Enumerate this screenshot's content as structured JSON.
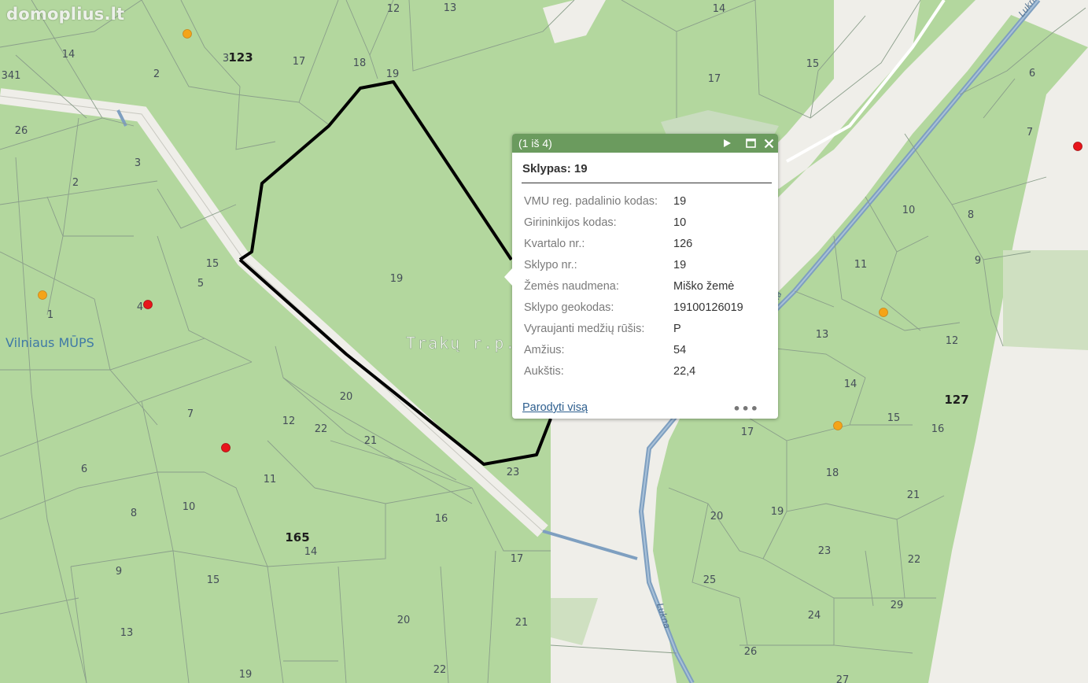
{
  "watermark": "domoplius.lt",
  "map": {
    "quarter_labels": [
      "123",
      "127",
      "165"
    ],
    "district_label": "Trakų r.p.",
    "mups_label": "Vilniaus MŪPS",
    "river_label": "Lukna",
    "parcel_labels": [
      "12",
      "13",
      "14",
      "15",
      "17",
      "2",
      "3",
      "14",
      "341",
      "18",
      "19",
      "26",
      "2",
      "3",
      "17",
      "6",
      "7",
      "10",
      "8",
      "11",
      "9",
      "15",
      "5",
      "19",
      "1",
      "4",
      "13",
      "12",
      "14",
      "15",
      "16",
      "20",
      "21",
      "22",
      "12",
      "7",
      "17",
      "18",
      "21",
      "6",
      "11",
      "23",
      "8",
      "10",
      "16",
      "20",
      "19",
      "9",
      "15",
      "14",
      "17",
      "25",
      "23",
      "22",
      "13",
      "20",
      "21",
      "24",
      "29",
      "26",
      "19",
      "22",
      "27"
    ],
    "colors": {
      "forest": "#b3d79e",
      "road": "#efeee9",
      "river": "#7e9fc0",
      "parcel_outline": "#000000",
      "point_red": "#e8151b",
      "point_orange": "#f4a418"
    }
  },
  "popup": {
    "counter": "(1 iš 4)",
    "next_icon": "play-icon",
    "maximize_icon": "maximize-icon",
    "close_icon": "close-icon",
    "title": "Sklypas: 19",
    "attributes": [
      {
        "key": "VMU reg. padalinio kodas:",
        "value": "19"
      },
      {
        "key": "Girininkijos kodas:",
        "value": "10"
      },
      {
        "key": "Kvartalo nr.:",
        "value": "126"
      },
      {
        "key": "Sklypo nr.:",
        "value": "19"
      },
      {
        "key": "Žemės naudmena:",
        "value": "Miško žemė"
      },
      {
        "key": "Sklypo geokodas:",
        "value": "19100126019"
      },
      {
        "key": "Vyraujanti medžių rūšis:",
        "value": "P"
      },
      {
        "key": "Amžius:",
        "value": "54"
      },
      {
        "key": "Aukštis:",
        "value": "22,4"
      }
    ],
    "show_all_label": "Parodyti visą",
    "more_label": "•••"
  }
}
